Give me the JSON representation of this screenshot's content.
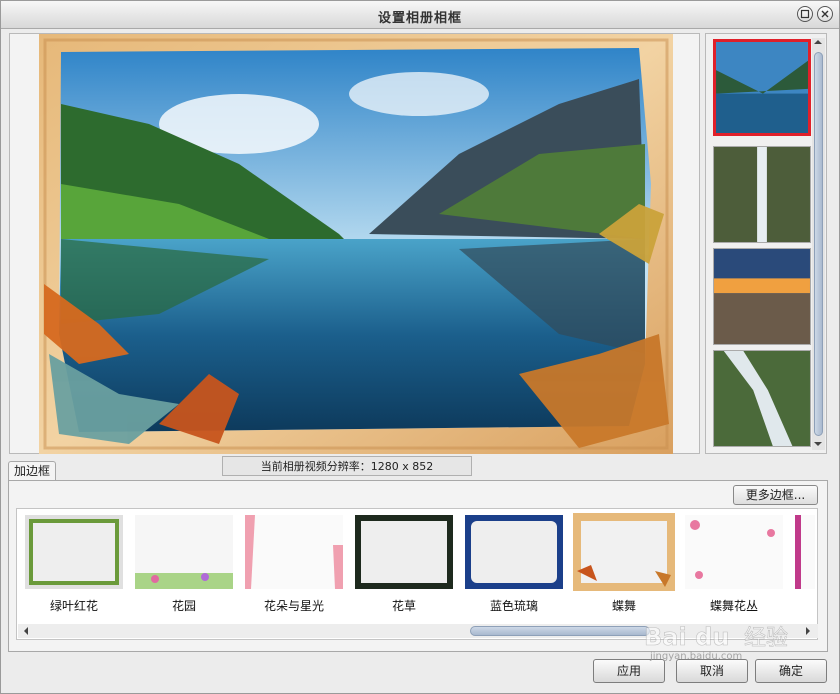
{
  "window": {
    "title": "设置相册相框"
  },
  "preview": {
    "resolution_label": "当前相册视频分辨率：1280 x 852"
  },
  "tabs": [
    {
      "label": "加边框"
    }
  ],
  "more_frames_label": "更多边框...",
  "frames": [
    {
      "label": "绿叶红花",
      "icon": "leaf-flower-frame"
    },
    {
      "label": "花园",
      "icon": "garden-frame"
    },
    {
      "label": "花朵与星光",
      "icon": "flower-star-frame"
    },
    {
      "label": "花草",
      "icon": "flower-grass-frame"
    },
    {
      "label": "蓝色琉璃",
      "icon": "blue-glaze-frame"
    },
    {
      "label": "蝶舞",
      "icon": "butterfly-dance-frame",
      "selected": true
    },
    {
      "label": "蝶舞花丛",
      "icon": "butterfly-flower-frame"
    }
  ],
  "buttons": {
    "apply": "应用",
    "cancel": "取消",
    "ok": "确定"
  },
  "watermark": {
    "text": "jingyan.baidu.com"
  },
  "colors": {
    "selected_border": "#e0202a",
    "accent": "#e6b97a"
  }
}
